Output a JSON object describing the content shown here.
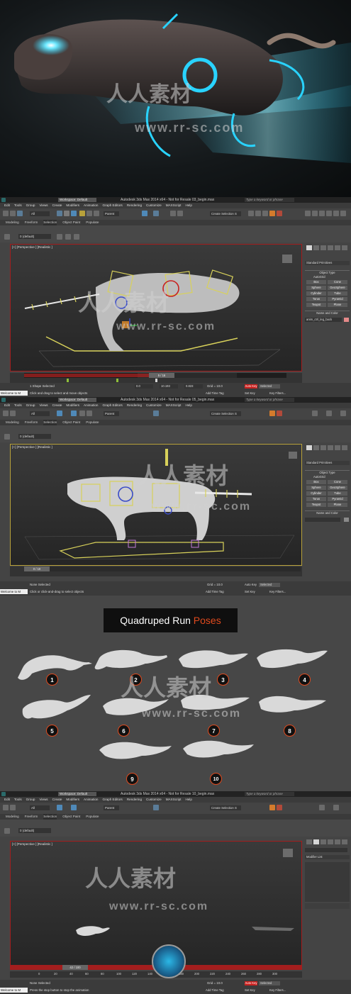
{
  "app": {
    "window_title_1": "Autodesk 3ds Max 2014 x64 - Not for Resale 03_begin.max",
    "window_title_2": "Autodesk 3ds Max 2014 x64 - Not for Resale 05_begin.max",
    "window_title_4": "Autodesk 3ds Max 2014 x64 - Not for Resale 10_begin.max",
    "workspace": "Workspace: Default",
    "search_placeholder": "Type a keyword or phrase"
  },
  "menu": [
    "Edit",
    "Tools",
    "Group",
    "Views",
    "Create",
    "Modifiers",
    "Animation",
    "Graph Editors",
    "Rendering",
    "Customize",
    "MAXScript",
    "Help"
  ],
  "ribbon_tabs": [
    "Modeling",
    "Freeform",
    "Selection",
    "Object Paint",
    "Populate"
  ],
  "toolbar": {
    "filter": "All",
    "ref_coord": "Parent",
    "layer": "0 (default)",
    "create_selection_set": "Create Selection S"
  },
  "viewport": {
    "label": "[+] [Perspective ] [Realistic ]"
  },
  "command_panel": {
    "dropdown": "Standard Primitives",
    "object_type_header": "Object Type",
    "autogrid": "AutoGrid",
    "buttons": [
      "Box",
      "Cone",
      "Sphere",
      "GeoSphere",
      "Cylinder",
      "Tube",
      "Torus",
      "Pyramid",
      "Teapot",
      "Plane"
    ],
    "name_color_header": "Name and Color",
    "object_name": "anim_ctrl_leg_back",
    "modifier_list": "Modifier List"
  },
  "timeline": {
    "panel1": "5 / 16",
    "panel2": "0 / 10",
    "panel4": "42 / 100",
    "ticks4": [
      "0",
      "20",
      "40",
      "60",
      "80",
      "100",
      "120",
      "140",
      "160",
      "180",
      "200",
      "220",
      "240",
      "260",
      "280",
      "300"
    ]
  },
  "status": {
    "welcome": "Welcome to M",
    "panel1_selected": "1 Shape Selected",
    "panel1_msg": "Click and drag to select and move objects",
    "panel1_x": "0.0",
    "panel1_y": "10.193",
    "panel1_z": "0.823",
    "panel2_selected": "None Selected",
    "panel2_msg": "Click or click-and-drag to select objects",
    "panel4_selected": "None Selected",
    "panel4_msg": "Press the stop button to stop the animation",
    "grid": "Grid = 10.0",
    "auto_key": "Auto Key",
    "set_key": "Set Key",
    "selected": "Selected",
    "add_time_tag": "Add Time Tag",
    "key_filters": "Key Filters..."
  },
  "poses": {
    "title_a": "Quadruped Run ",
    "title_b": "Poses",
    "numbers": [
      "1",
      "2",
      "3",
      "4",
      "5",
      "6",
      "7",
      "8",
      "9",
      "10"
    ]
  },
  "watermark": {
    "cn": "人人素材",
    "url": "www.rr-sc.com"
  },
  "colors": {
    "accent_red": "#c8201e",
    "pose_orange": "#e04a1e",
    "glow_cyan": "#29d3ff",
    "viewport_border": "#a31e1e",
    "active_yellow": "#b8a13a"
  }
}
